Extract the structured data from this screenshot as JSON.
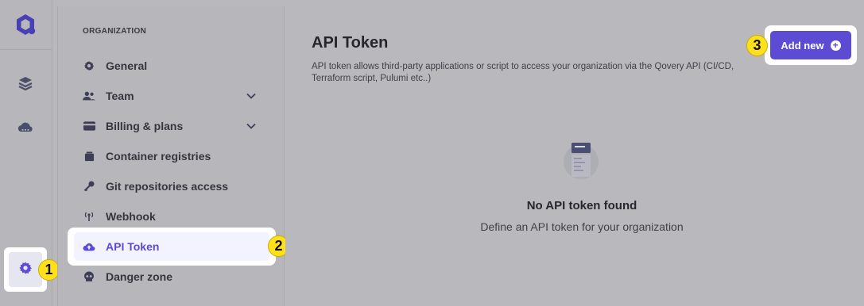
{
  "rail": {
    "items": [
      {
        "icon": "qovery-logo"
      },
      {
        "icon": "layers-icon"
      },
      {
        "icon": "cloud-icon"
      },
      {
        "icon": "gear-icon"
      }
    ]
  },
  "steps": {
    "one": "1",
    "two": "2",
    "three": "3"
  },
  "settings_nav": {
    "section_title": "ORGANIZATION",
    "items": [
      {
        "label": "General",
        "icon": "gear-icon"
      },
      {
        "label": "Team",
        "icon": "users-icon"
      },
      {
        "label": "Billing & plans",
        "icon": "credit-card-icon"
      },
      {
        "label": "Container registries",
        "icon": "box-icon"
      },
      {
        "label": "Git repositories access",
        "icon": "key-icon"
      },
      {
        "label": "Webhook",
        "icon": "broadcast-icon"
      },
      {
        "label": "API Token",
        "icon": "cloud-upload-icon"
      },
      {
        "label": "Danger zone",
        "icon": "skull-icon"
      }
    ]
  },
  "main": {
    "title": "API Token",
    "description": "API token allows third-party applications or script to access your organization via the Qovery API (CI/CD, Terraform script, Pulumi etc..)",
    "add_button_label": "Add new",
    "empty_title": "No API token found",
    "empty_subtitle": "Define an API token for your organization"
  },
  "colors": {
    "accent": "#5c4bd3",
    "badge": "#ffe01b"
  }
}
